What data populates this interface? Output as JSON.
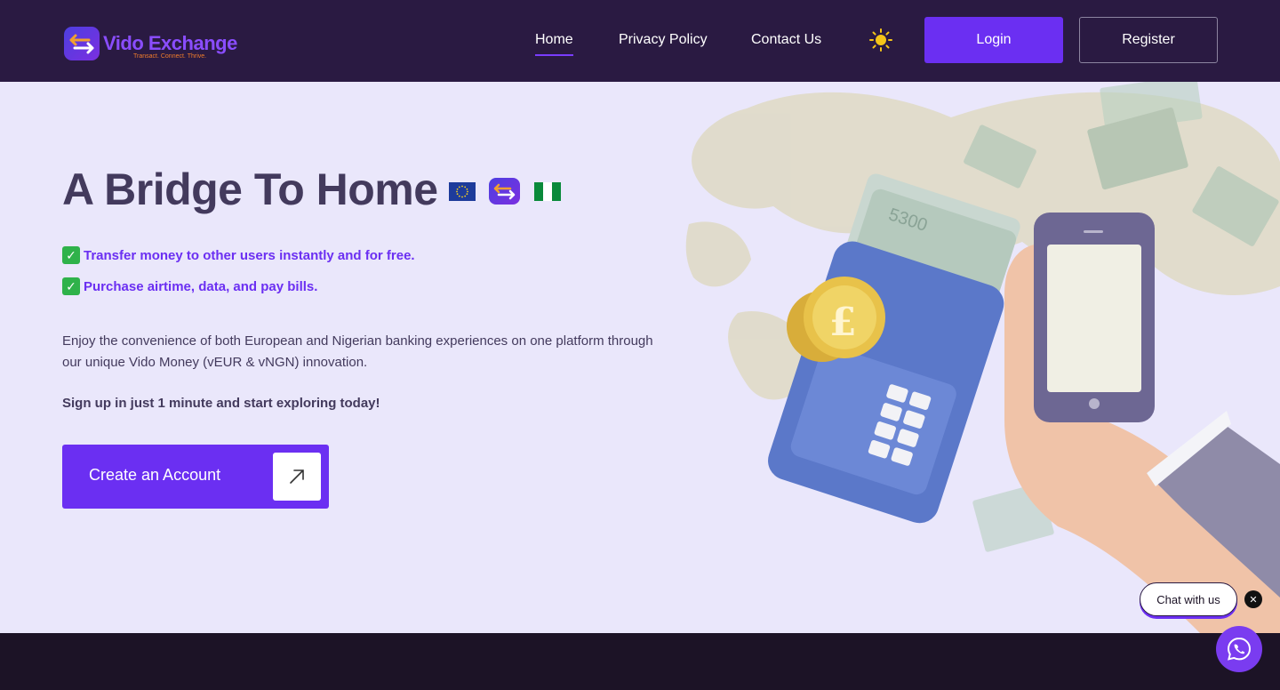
{
  "brand": {
    "name": "Vido Exchange",
    "tagline": "Transact. Connect. Thrive.",
    "accent": "#6b2ff2",
    "nav_bg": "#2a1a42",
    "tagline_color": "#f07d2b"
  },
  "nav": {
    "links": [
      {
        "label": "Home",
        "active": true
      },
      {
        "label": "Privacy Policy",
        "active": false
      },
      {
        "label": "Contact Us",
        "active": false
      }
    ],
    "theme_icon": "sun-icon",
    "login_label": "Login",
    "register_label": "Register"
  },
  "hero": {
    "title": "A Bridge To Home",
    "flags": [
      "eu-flag-icon",
      "vido-logo-icon",
      "nigeria-flag-icon"
    ],
    "features": [
      "Transfer money to other users instantly and for free.",
      "Purchase airtime, data, and pay bills."
    ],
    "feature_icon": "check-mark-icon",
    "description": "Enjoy the convenience of both European and Nigerian banking experiences on one platform through our unique Vido Money (vEUR & vNGN) innovation.",
    "signup_note": "Sign up in just 1 minute and start exploring today!",
    "cta_label": "Create an Account",
    "cta_icon": "arrow-up-right-icon",
    "illustration": "hand-holding-phone-with-wallet-money-and-euro-coin"
  },
  "chat": {
    "label": "Chat with us",
    "close_icon": "close-icon",
    "whatsapp_icon": "whatsapp-icon"
  }
}
